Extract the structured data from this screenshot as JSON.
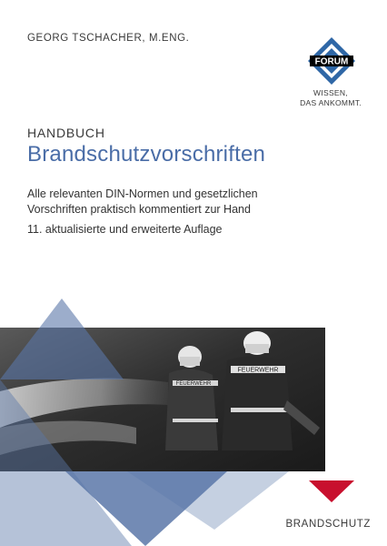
{
  "cover": {
    "author": "GEORG TSCHACHER, M.ENG.",
    "publisher_logo_text": "FORUM",
    "publisher_tagline": [
      "WISSEN,",
      "DAS ANKOMMT."
    ],
    "kicker": "HANDBUCH",
    "title": "Brandschutzvorschriften",
    "subtitle_lines": [
      "Alle relevanten DIN-Normen und gesetzlichen",
      "Vorschriften praktisch kommentiert zur Hand"
    ],
    "edition": "11. aktualisierte und erweiterte Auflage",
    "category": "BRANDSCHUTZ",
    "photo_labels": [
      "FEUERWEHR",
      "FEUERWEHR"
    ]
  },
  "colors": {
    "title_blue": "#4a6da7",
    "logo_blue": "#2f67a6",
    "triangle_blue": "#5a77a8",
    "accent_red": "#c8102e",
    "text_dark": "#3a3a3a"
  }
}
